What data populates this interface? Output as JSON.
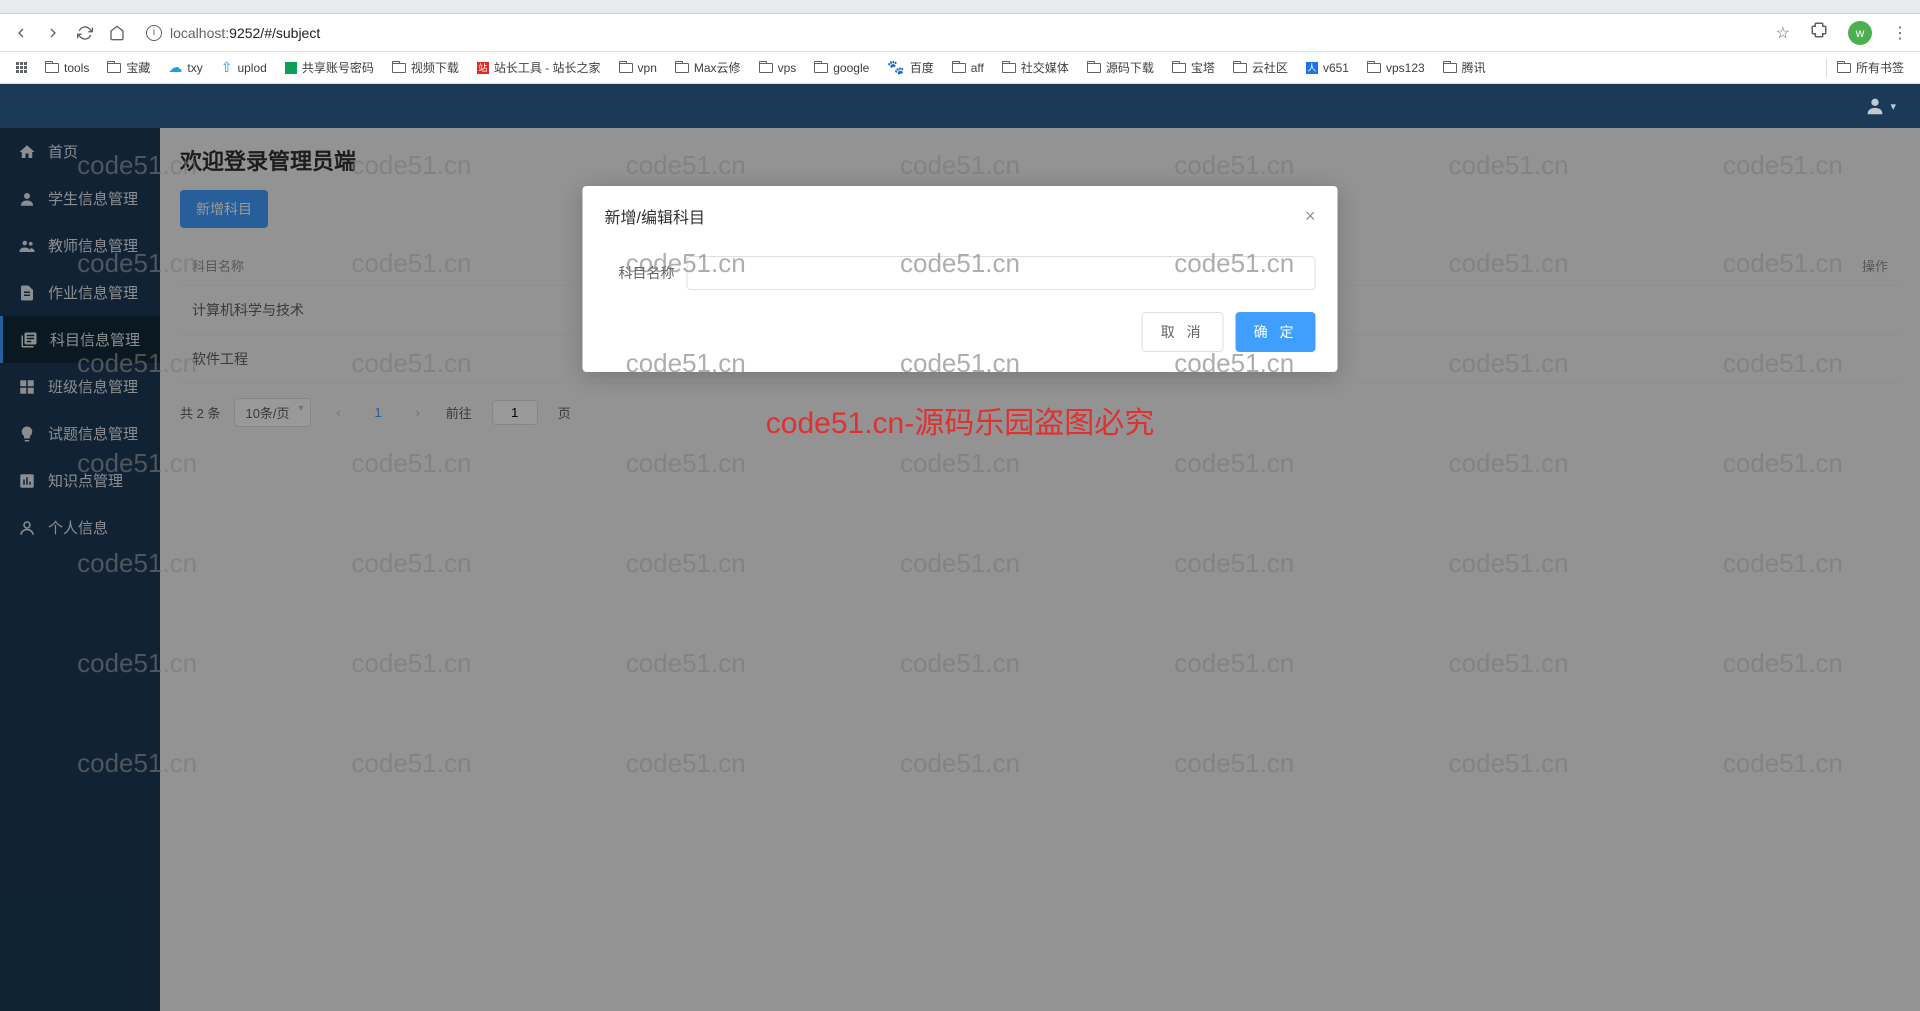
{
  "browser": {
    "url_host": "localhost:",
    "url_rest": "9252/#/subject",
    "avatar_letter": "w"
  },
  "bookmarks": {
    "items": [
      "tools",
      "宝藏",
      "txy",
      "uplod",
      "共享账号密码",
      "视频下载",
      "站长工具 - 站长之家",
      "vpn",
      "Max云修",
      "vps",
      "google",
      "百度",
      "aff",
      "社交媒体",
      "源码下载",
      "宝塔",
      "云社区",
      "v651",
      "vps123",
      "腾讯"
    ],
    "all": "所有书签"
  },
  "sidebar": {
    "items": [
      {
        "label": "首页"
      },
      {
        "label": "学生信息管理"
      },
      {
        "label": "教师信息管理"
      },
      {
        "label": "作业信息管理"
      },
      {
        "label": "科目信息管理"
      },
      {
        "label": "班级信息管理"
      },
      {
        "label": "试题信息管理"
      },
      {
        "label": "知识点管理"
      },
      {
        "label": "个人信息"
      }
    ]
  },
  "main": {
    "title": "欢迎登录管理员端",
    "add_btn": "新增科目",
    "col_name": "科目名称",
    "col_ops": "操作",
    "rows": [
      {
        "name": "计算机科学与技术"
      },
      {
        "name": "软件工程"
      }
    ],
    "pagination": {
      "total": "共 2 条",
      "per_page": "10条/页",
      "current": "1",
      "goto_prefix": "前往",
      "goto_val": "1",
      "goto_suffix": "页"
    }
  },
  "dialog": {
    "title": "新增/编辑科目",
    "label": "科目名称",
    "input_value": "",
    "cancel": "取 消",
    "confirm": "确 定"
  },
  "watermark": {
    "red": "code51.cn-源码乐园盗图必究",
    "grey": "code51.cn"
  }
}
